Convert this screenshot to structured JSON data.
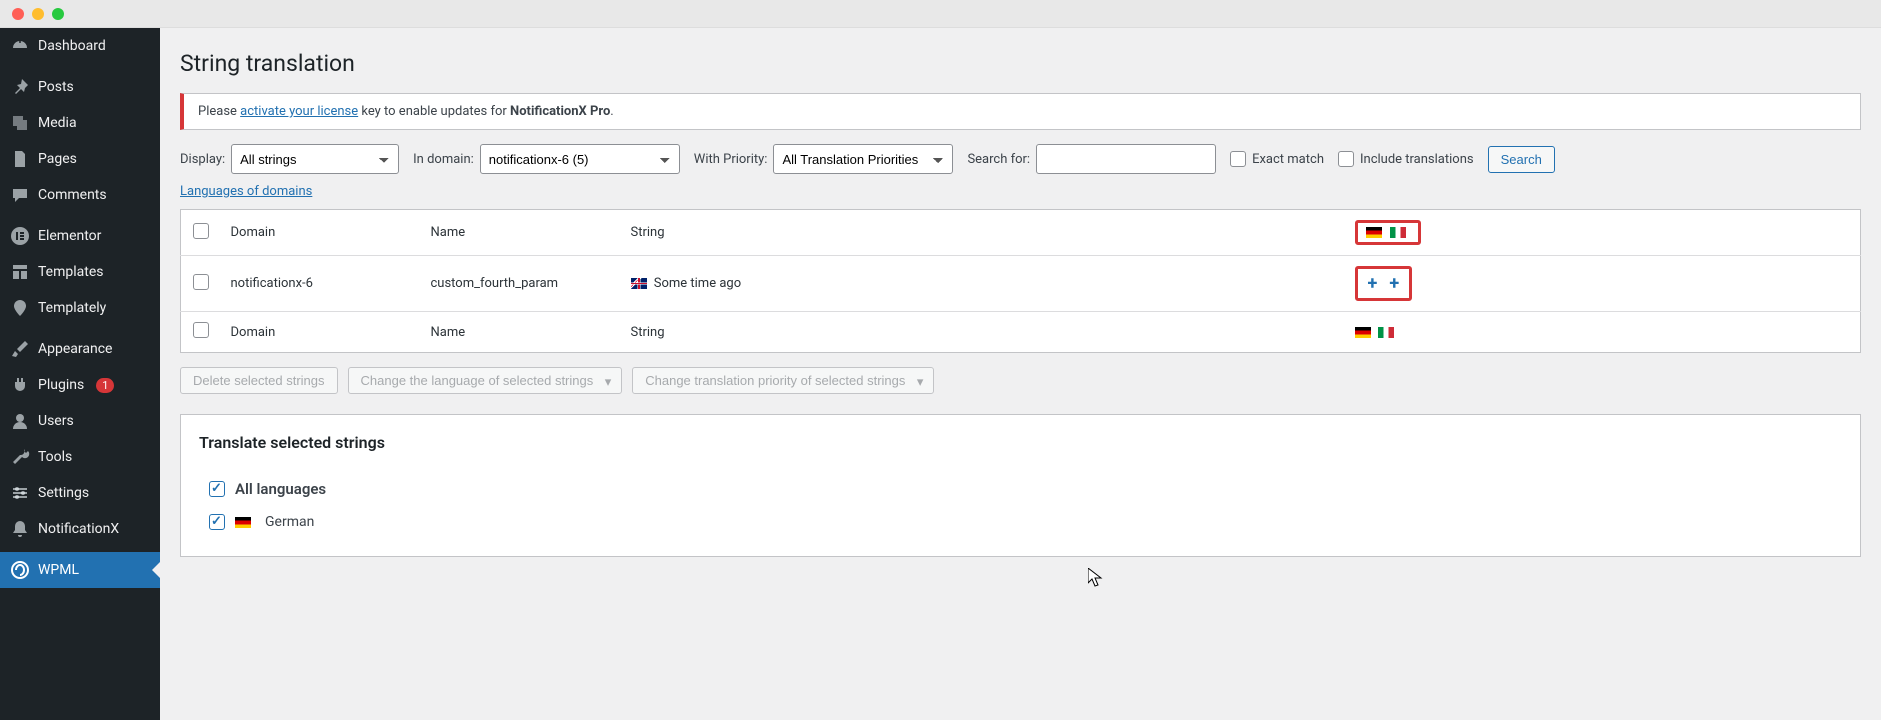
{
  "sidebar": {
    "items": [
      {
        "label": "Dashboard",
        "icon": "dashboard"
      },
      {
        "label": "Posts",
        "icon": "pin"
      },
      {
        "label": "Media",
        "icon": "media"
      },
      {
        "label": "Pages",
        "icon": "page"
      },
      {
        "label": "Comments",
        "icon": "comment"
      },
      {
        "label": "Elementor",
        "icon": "elementor"
      },
      {
        "label": "Templates",
        "icon": "templates"
      },
      {
        "label": "Templately",
        "icon": "templately"
      },
      {
        "label": "Appearance",
        "icon": "brush"
      },
      {
        "label": "Plugins",
        "icon": "plugin",
        "badge": "1"
      },
      {
        "label": "Users",
        "icon": "user"
      },
      {
        "label": "Tools",
        "icon": "wrench"
      },
      {
        "label": "Settings",
        "icon": "settings"
      },
      {
        "label": "NotificationX",
        "icon": "notificationx"
      },
      {
        "label": "WPML",
        "icon": "wpml",
        "active": true
      }
    ]
  },
  "page": {
    "title": "String translation",
    "notice_prefix": "Please ",
    "notice_link": "activate your license",
    "notice_suffix_1": " key to enable updates for ",
    "notice_bold": "NotificationX Pro",
    "notice_suffix_2": "."
  },
  "filters": {
    "display_label": "Display:",
    "display_value": "All strings",
    "domain_label": "In domain:",
    "domain_value": "notificationx-6 (5)",
    "priority_label": "With Priority:",
    "priority_value": "All Translation Priorities",
    "search_label": "Search for:",
    "exact_label": "Exact match",
    "include_label": "Include translations",
    "search_btn": "Search",
    "lang_link": "Languages of domains"
  },
  "table": {
    "headers": {
      "domain": "Domain",
      "name": "Name",
      "string": "String"
    },
    "rows": [
      {
        "domain": "notificationx-6",
        "name": "custom_fourth_param",
        "string": "Some time ago"
      }
    ],
    "footers": {
      "domain": "Domain",
      "name": "Name",
      "string": "String"
    }
  },
  "bulk": {
    "delete": "Delete selected strings",
    "change_lang": "Change the language of selected strings",
    "change_priority": "Change translation priority of selected strings"
  },
  "translate_panel": {
    "title": "Translate selected strings",
    "all_languages": "All languages",
    "german": "German"
  }
}
